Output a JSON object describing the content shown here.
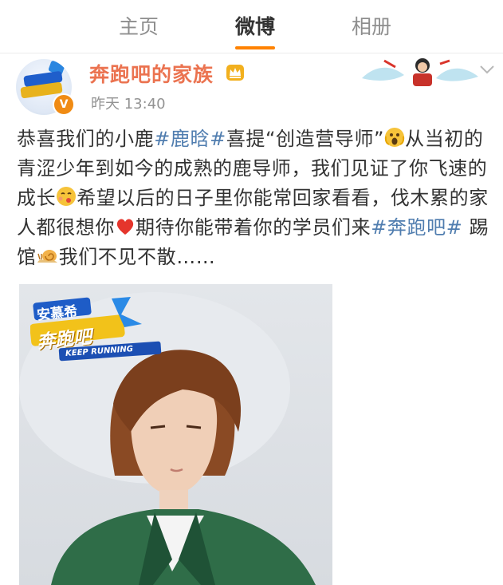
{
  "tabs": [
    {
      "label": "主页",
      "active": false
    },
    {
      "label": "微博",
      "active": true
    },
    {
      "label": "相册",
      "active": false
    }
  ],
  "post": {
    "author": "奔跑吧的家族",
    "verified_badge": "V",
    "timestamp": "昨天 13:40",
    "text_segments": [
      {
        "text": "恭喜我们的小鹿",
        "type": "text"
      },
      {
        "text": "#鹿晗#",
        "type": "hashtag"
      },
      {
        "text": "喜提“创造营导师”",
        "type": "text"
      },
      {
        "icon": "shocked-face-icon",
        "type": "emoji"
      },
      {
        "text": "从当初的青涩少年到如今的成熟的鹿导师，我们见证了你飞速的成长",
        "type": "text"
      },
      {
        "icon": "kiss-face-icon",
        "type": "emoji"
      },
      {
        "text": "希望以后的日子里你能常回家看看，伐木累的家人都很想你",
        "type": "text"
      },
      {
        "icon": "red-heart-icon",
        "type": "emoji"
      },
      {
        "text": "期待你能带着你的学员们来",
        "type": "text"
      },
      {
        "text": "#奔跑吧#",
        "type": "hashtag"
      },
      {
        "text": " 踢馆",
        "type": "text"
      },
      {
        "icon": "snail-icon",
        "type": "emoji"
      },
      {
        "text": "我们不见不散……",
        "type": "text"
      }
    ],
    "image": {
      "logo_line1": "安慕希",
      "logo_line2": "奔跑吧",
      "logo_line3": "KEEP RUNNING"
    }
  },
  "colors": {
    "accent": "#ff8200",
    "username": "#eb7350",
    "hashtag": "#507daf",
    "timestamp": "#939393"
  }
}
